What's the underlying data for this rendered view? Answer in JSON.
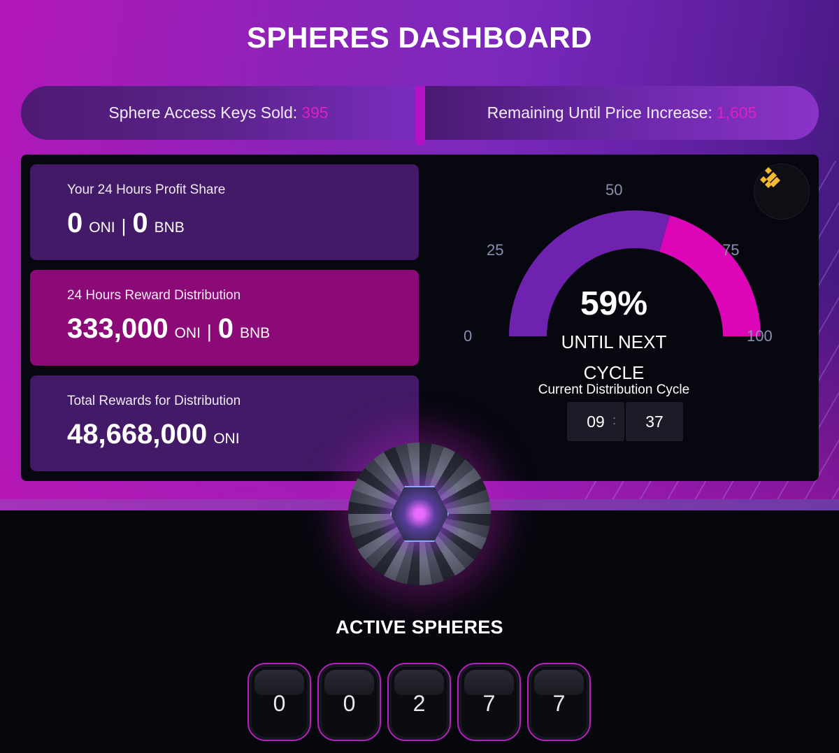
{
  "title": "SPHERES DASHBOARD",
  "stats": {
    "keys_sold_label": "Sphere Access Keys Sold:",
    "keys_sold_value": "395",
    "remaining_label": "Remaining Until Price Increase:",
    "remaining_value": "1,605"
  },
  "cards": {
    "profit_share": {
      "label": "Your 24 Hours Profit Share",
      "oni_value": "0",
      "oni_unit": "ONI",
      "separator": "|",
      "bnb_value": "0",
      "bnb_unit": "BNB"
    },
    "reward_distribution": {
      "label": "24 Hours Reward Distribution",
      "oni_value": "333,000",
      "oni_unit": "ONI",
      "separator": "|",
      "bnb_value": "0",
      "bnb_unit": "BNB"
    },
    "total_rewards": {
      "label": "Total Rewards for Distribution",
      "oni_value": "48,668,000",
      "oni_unit": "ONI"
    }
  },
  "gauge": {
    "percent": 59,
    "percent_text": "59%",
    "caption_line1": "UNTIL NEXT",
    "caption_line2": "CYCLE",
    "ticks": [
      "0",
      "25",
      "50",
      "75",
      "100"
    ],
    "fill_color": "#6f22b0",
    "remaining_color": "#dc06b8"
  },
  "cycle": {
    "label": "Current Distribution Cycle",
    "hours": "09",
    "separator": ":",
    "minutes": "37"
  },
  "bnb_icon": "bnb-icon",
  "active_spheres": {
    "title": "ACTIVE SPHERES",
    "digits": [
      "0",
      "0",
      "2",
      "7",
      "7"
    ]
  },
  "colors": {
    "accent": "#e01fc0",
    "card_purple": "#431a67",
    "card_magenta": "#8c0a78",
    "panel": "#070710"
  }
}
